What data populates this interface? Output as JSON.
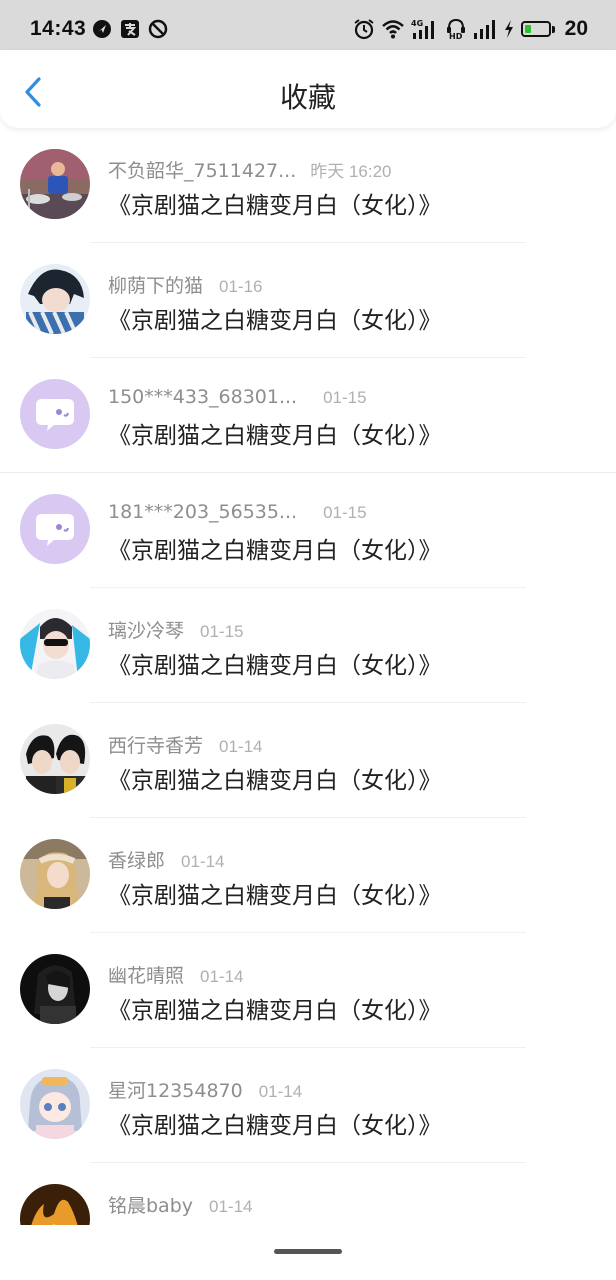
{
  "status_bar": {
    "time": "14:43",
    "battery_percent": "20",
    "left_icons": [
      "navigation-icon",
      "pay-icon",
      "do-not-disturb-icon"
    ],
    "right_icons": [
      "alarm-icon",
      "wifi-icon",
      "signal-4g-icon",
      "hd-voice-icon",
      "signal-icon",
      "charging-icon",
      "battery-icon"
    ],
    "battery_color": "#28c32b"
  },
  "nav": {
    "title": "收藏",
    "back_icon": "chevron-left-icon",
    "accent": "#2f8ee0"
  },
  "items": [
    {
      "username": "不负韶华_7511427...",
      "time": "昨天 16:20",
      "content": "《京剧猫之白糖变月白（女化）》",
      "avatar": "drummer-photo"
    },
    {
      "username": "柳荫下的猫",
      "time": "01-16",
      "content": "《京剧猫之白糖变月白（女化）》",
      "avatar": "anime-boy-photo"
    },
    {
      "username": "150***433_68301...",
      "time": "01-15",
      "content": "《京剧猫之白糖变月白（女化）》",
      "avatar": "default-chat-avatar"
    },
    {
      "username": "181***203_56535...",
      "time": "01-15",
      "content": "《京剧猫之白糖变月白（女化）》",
      "avatar": "default-chat-avatar"
    },
    {
      "username": "璃沙冷琴",
      "time": "01-15",
      "content": "《京剧猫之白糖变月白（女化）》",
      "avatar": "masked-boy-photo"
    },
    {
      "username": "西行寺香芳",
      "time": "01-14",
      "content": "《京剧猫之白糖变月白（女化）》",
      "avatar": "two-boys-photo"
    },
    {
      "username": "香绿郎",
      "time": "01-14",
      "content": "《京剧猫之白糖变月白（女化）》",
      "avatar": "blonde-girl-photo"
    },
    {
      "username": "幽花晴照",
      "time": "01-14",
      "content": "《京剧猫之白糖变月白（女化）》",
      "avatar": "dark-figure-photo"
    },
    {
      "username": "星河12354870",
      "time": "01-14",
      "content": "《京剧猫之白糖变月白（女化）》",
      "avatar": "anime-girl-photo"
    },
    {
      "username": "铭晨baby",
      "time": "01-14",
      "content": "",
      "avatar": "fire-photo"
    }
  ]
}
